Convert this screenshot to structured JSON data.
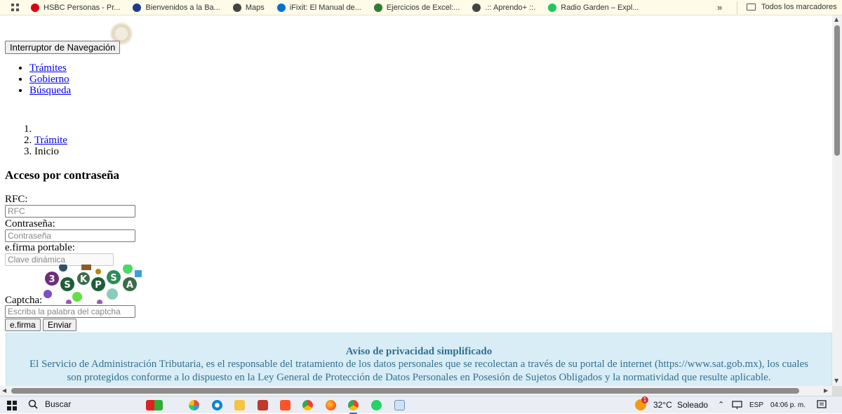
{
  "bookmarks_bar": {
    "items": [
      {
        "label": "HSBC Personas - Pr...",
        "color": "#db0011"
      },
      {
        "label": "Bienvenidos a la Ba...",
        "color": "#1f3a8a"
      },
      {
        "label": "Maps",
        "color": "#444444"
      },
      {
        "label": "iFixit: El Manual de...",
        "color": "#0071ce"
      },
      {
        "label": "Ejercicios de Excel:...",
        "color": "#2e7d32"
      },
      {
        "label": ".:: Aprendo+ ::.",
        "color": "#444444"
      },
      {
        "label": "Radio Garden – Expl...",
        "color": "#22c55e"
      }
    ],
    "more": "»",
    "all_bookmarks": "Todos los marcadores"
  },
  "page": {
    "nav_toggle_label": "Interruptor de Navegación",
    "nav_links": [
      "Trámites",
      "Gobierno",
      "Búsqueda"
    ],
    "breadcrumb": [
      "",
      "Trámite",
      "Inicio"
    ],
    "form": {
      "title": "Acceso por contraseña",
      "rfc_label": "RFC:",
      "rfc_placeholder": "RFC",
      "password_label": "Contraseña:",
      "password_placeholder": "Contraseña",
      "efirma_label": "e.firma portable:",
      "efirma_placeholder": "Clave dinámica",
      "captcha_label": "Captcha:",
      "captcha_text": "3SKPSA",
      "captcha_placeholder": "Escriba la palabra del captcha",
      "efirma_button": "e.firma",
      "submit_button": "Enviar"
    },
    "privacy_notice": {
      "title": "Aviso de privacidad simplificado",
      "line1": "El Servicio de Administración Tributaria, es el responsable del tratamiento de los datos personales que se recolectan a través de su portal de internet (https://www.sat.gob.mx), los cuales",
      "line2": "son protegidos conforme a lo dispuesto en la Ley General de Protección de Datos Personales en Posesión de Sujetos Obligados y la normatividad que resulte aplicable."
    }
  },
  "taskbar": {
    "search_label": "Buscar",
    "weather_badge": "1",
    "temperature": "32°C",
    "weather": "Soleado",
    "language": "ESP",
    "time": "04:06 p. m."
  }
}
